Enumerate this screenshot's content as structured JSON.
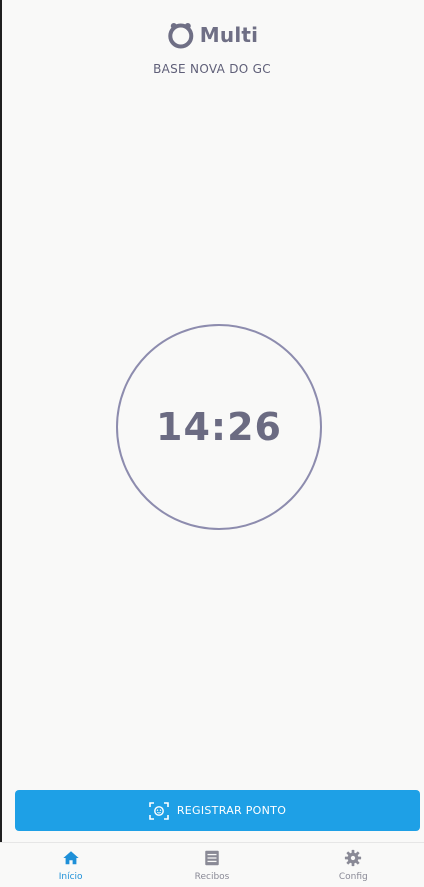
{
  "header": {
    "logo_text": "Multi",
    "subtitle": "BASE NOVA DO GC"
  },
  "clock": {
    "time": "14:26"
  },
  "action": {
    "register_label": "REGISTRAR PONTO"
  },
  "tabs": [
    {
      "label": "Início",
      "icon": "home-icon",
      "active": true
    },
    {
      "label": "Recibos",
      "icon": "receipt-icon",
      "active": false
    },
    {
      "label": "Config",
      "icon": "gear-icon",
      "active": false
    }
  ],
  "colors": {
    "accent": "#1ea0e6",
    "active_tab": "#1e90d8",
    "inactive_tab": "#8a8a96",
    "text_dark": "#6b6b82",
    "circle": "#8d8cae",
    "background": "#f9f9f8"
  }
}
